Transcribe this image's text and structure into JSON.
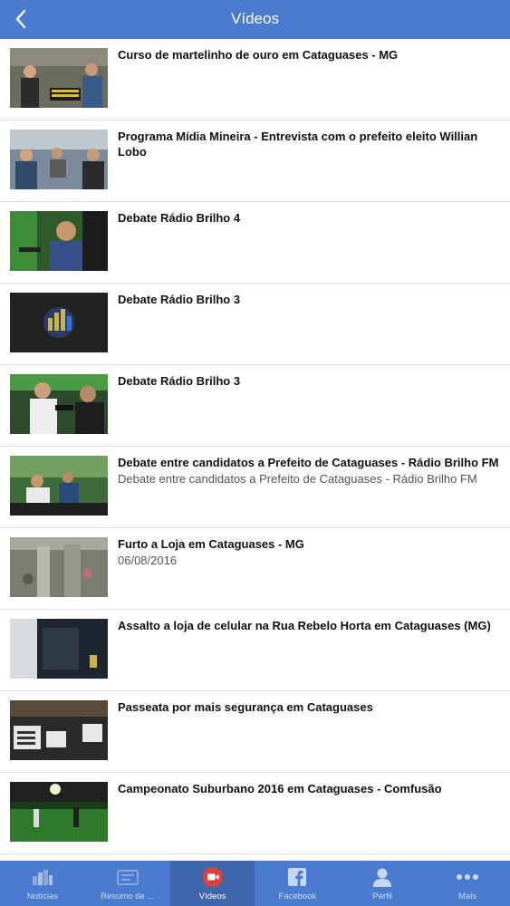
{
  "header": {
    "title": "Vídeos"
  },
  "videos": [
    {
      "title": "Curso de martelinho de ouro em Cataguases - MG",
      "subtitle": "",
      "thumb": "studio"
    },
    {
      "title": "Programa Mídia Mineira - Entrevista com o prefeito eleito Willian Lobo",
      "subtitle": "",
      "thumb": "studio2"
    },
    {
      "title": "Debate Rádio Brilho 4",
      "subtitle": "",
      "thumb": "green"
    },
    {
      "title": "Debate Rádio Brilho 3",
      "subtitle": "",
      "thumb": "logo"
    },
    {
      "title": "Debate Rádio Brilho 3",
      "subtitle": "",
      "thumb": "green2"
    },
    {
      "title": "Debate entre candidatos a Prefeito de Cataguases - Rádio Brilho FM",
      "subtitle": "Debate entre candidatos a Prefeito de Cataguases - Rádio Brilho FM",
      "thumb": "debate"
    },
    {
      "title": "Furto a Loja em Cataguases - MG",
      "subtitle": "06/08/2016",
      "thumb": "cctv"
    },
    {
      "title": "Assalto a loja de celular na Rua Rebelo Horta em Cataguases (MG)",
      "subtitle": "",
      "thumb": "dark"
    },
    {
      "title": "Passeata por mais segurança em Cataguases",
      "subtitle": "",
      "thumb": "protest"
    },
    {
      "title": "Campeonato Suburbano 2016 em Cataguases - Comfusão",
      "subtitle": "",
      "thumb": "field"
    }
  ],
  "tabs": [
    {
      "label": "Notícias",
      "icon": "news-icon"
    },
    {
      "label": "Resumo de ...",
      "icon": "summary-icon"
    },
    {
      "label": "Vídeos",
      "icon": "video-icon",
      "active": true
    },
    {
      "label": "Facebook",
      "icon": "facebook-icon"
    },
    {
      "label": "Perfil",
      "icon": "profile-icon"
    },
    {
      "label": "Mais",
      "icon": "more-icon"
    }
  ]
}
